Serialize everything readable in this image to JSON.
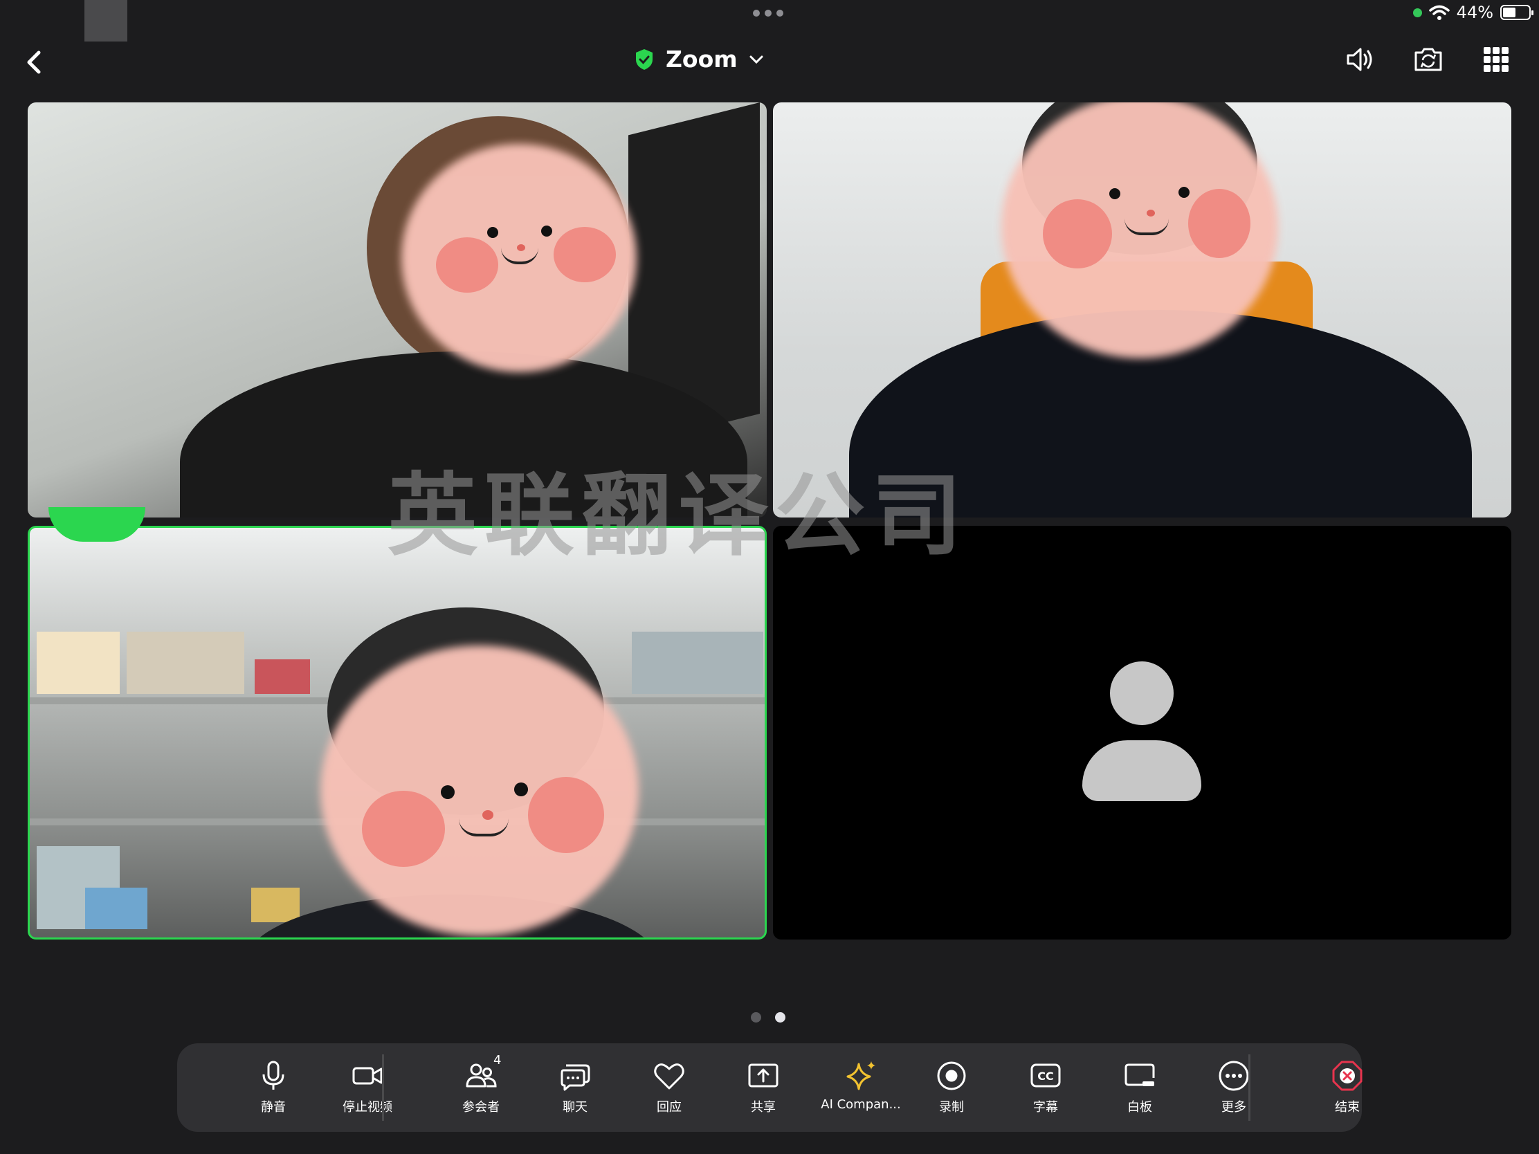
{
  "status_bar": {
    "battery": "44%",
    "battery_level": 0.44
  },
  "header": {
    "title": "Zoom"
  },
  "watermark": "英联翻译公司",
  "pager": {
    "pages": 2,
    "active": 2
  },
  "toolbar": {
    "mute_label": "静音",
    "stop_video_label": "停止视频",
    "participants_label": "参会者",
    "participants_count": "4",
    "chat_label": "聊天",
    "reactions_label": "回应",
    "share_label": "共享",
    "ai_label": "AI Compan...",
    "record_label": "录制",
    "captions_label": "字幕",
    "whiteboard_label": "白板",
    "more_label": "更多",
    "end_label": "结束"
  },
  "colors": {
    "accent": "#2bd64f",
    "end_red": "#e8344e",
    "ai_gold": "#f2c230",
    "toolbar_bg": "#303033"
  },
  "icons": [
    "back-arrow-icon",
    "shield-check-icon",
    "chevron-down-icon",
    "speaker-icon",
    "camera-switch-icon",
    "grid-icon",
    "microphone-icon",
    "video-camera-icon",
    "participants-icon",
    "chat-icon",
    "heart-icon",
    "share-screen-icon",
    "sparkle-icon",
    "record-icon",
    "cc-icon",
    "whiteboard-icon",
    "more-icon",
    "end-icon"
  ]
}
